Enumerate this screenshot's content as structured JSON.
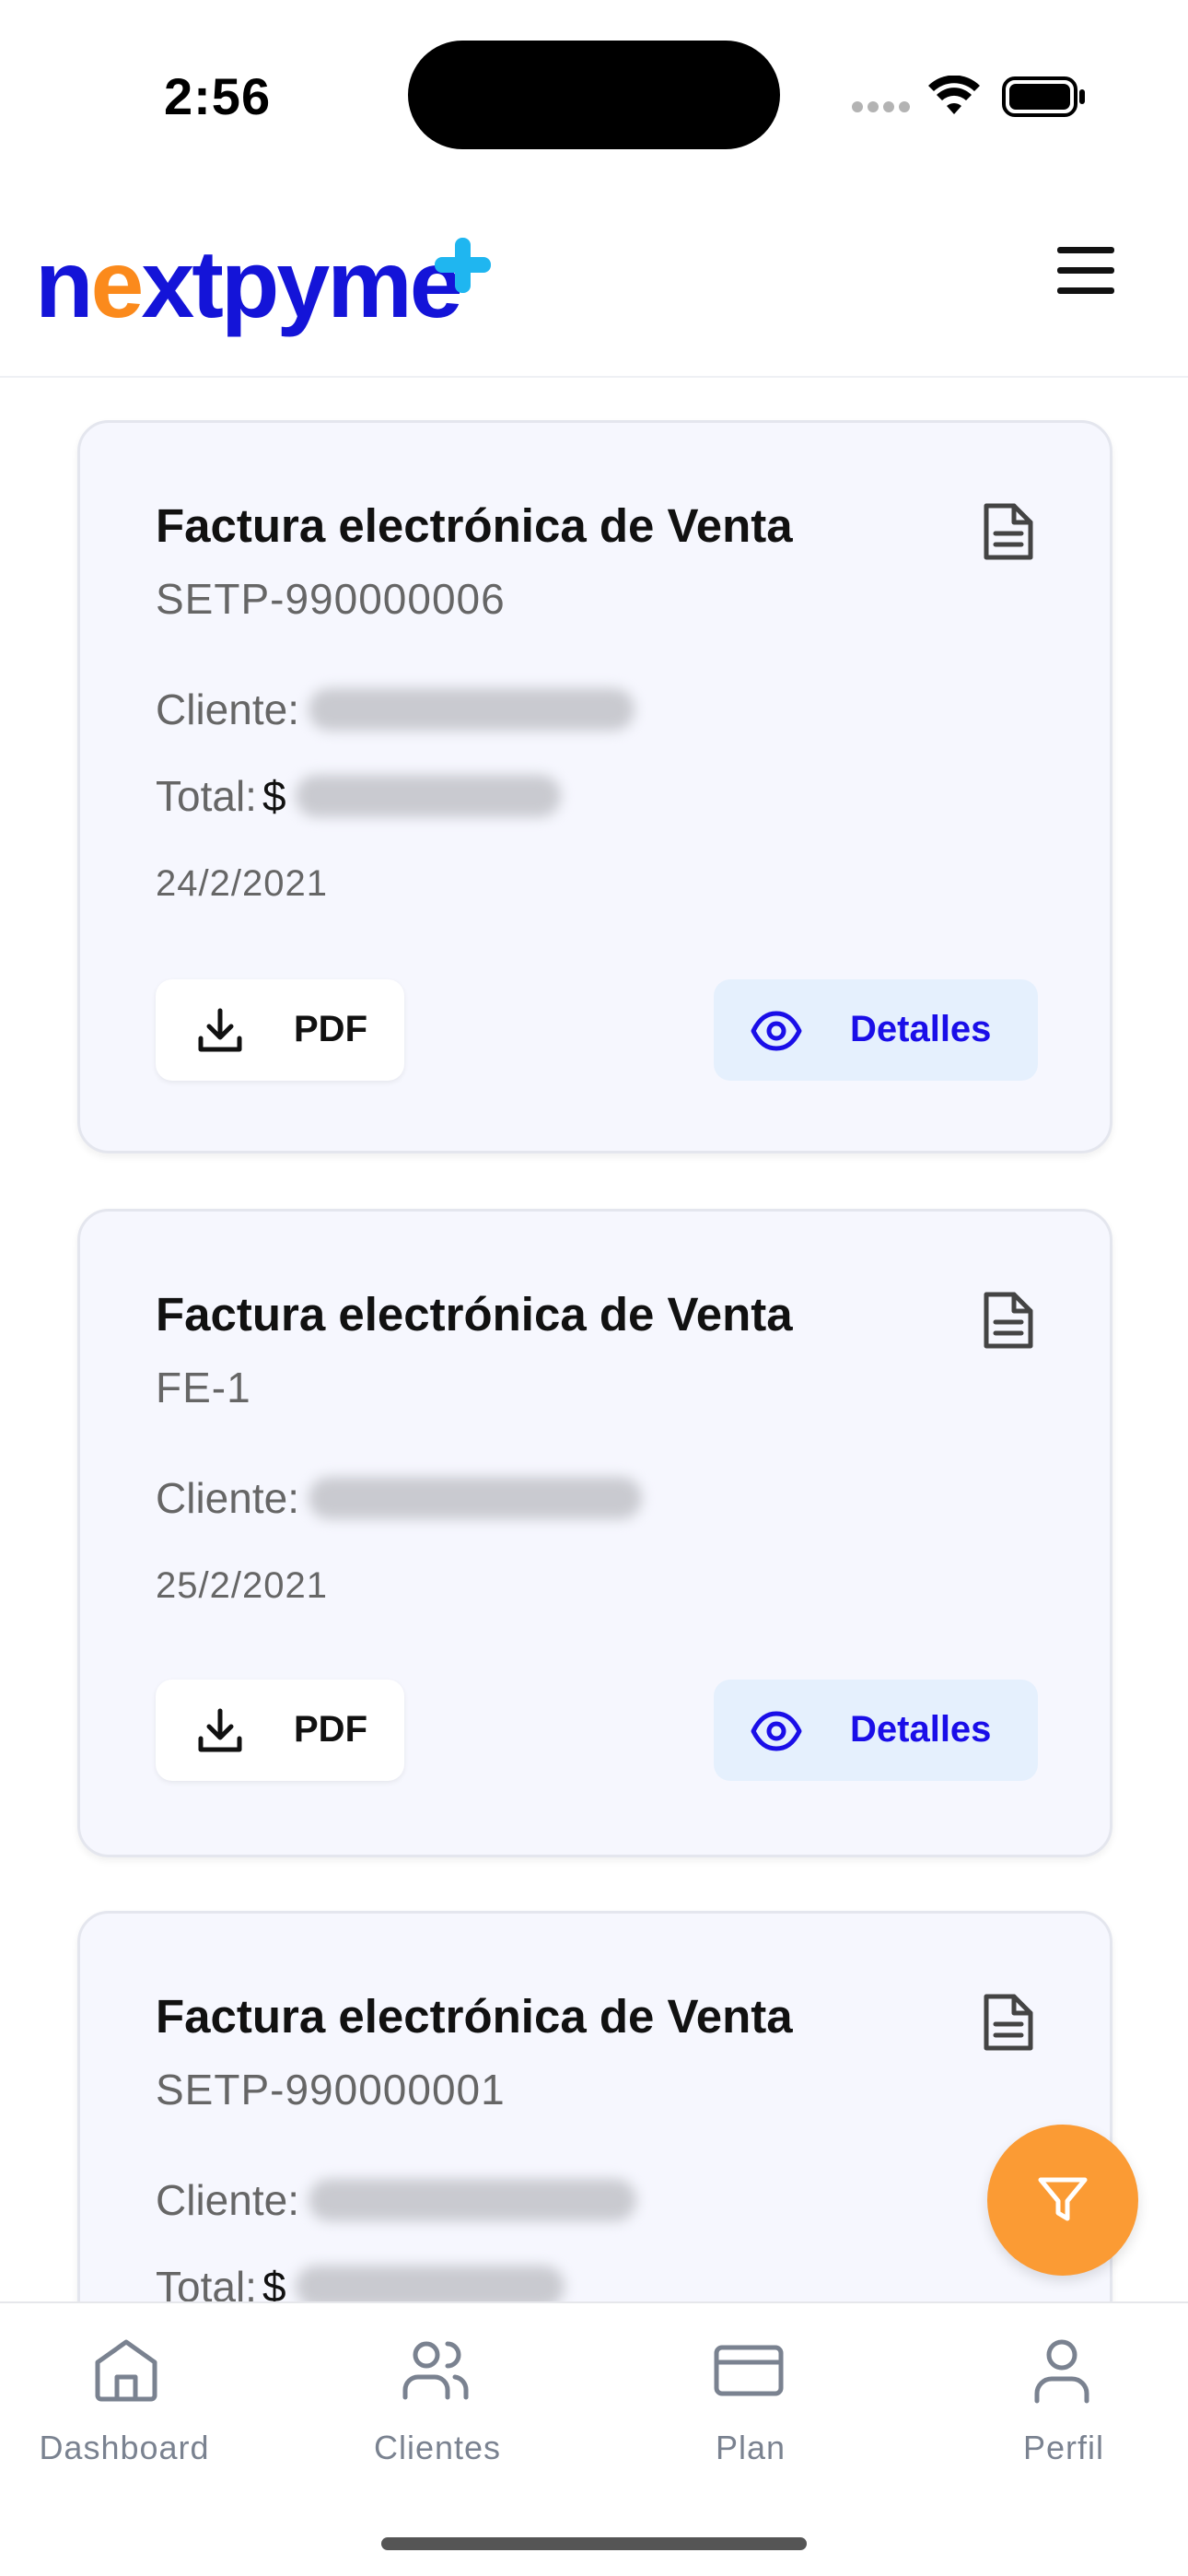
{
  "status_bar": {
    "time": "2:56",
    "signal_icon": "cellular-signal-icon",
    "wifi_icon": "wifi-icon",
    "battery_icon": "battery-icon"
  },
  "header": {
    "logo_text": "nextpyme",
    "logo_colors": {
      "primary": "#1414d8",
      "accent_orange": "#fb8a1c",
      "accent_plus": "#1fb6f0"
    },
    "menu_icon": "hamburger-menu-icon"
  },
  "invoices": [
    {
      "title": "Factura electrónica de Venta",
      "number": "SETP-990000006",
      "client_label": "Cliente:",
      "total_label": "Total:",
      "currency": "$",
      "date": "24/2/2021",
      "pdf_label": "PDF",
      "details_label": "Detalles"
    },
    {
      "title": "Factura electrónica de Venta",
      "number": "FE-1",
      "client_label": "Cliente:",
      "date": "25/2/2021",
      "pdf_label": "PDF",
      "details_label": "Detalles"
    },
    {
      "title": "Factura electrónica de Venta",
      "number": "SETP-990000001",
      "client_label": "Cliente:",
      "total_label": "Total:",
      "currency": "$"
    }
  ],
  "fab": {
    "icon": "filter-icon",
    "color": "#fb9b34"
  },
  "bottom_nav": {
    "items": [
      {
        "label": "Dashboard",
        "icon": "home-icon"
      },
      {
        "label": "Clientes",
        "icon": "users-icon"
      },
      {
        "label": "Plan",
        "icon": "credit-card-icon"
      },
      {
        "label": "Perfil",
        "icon": "user-icon"
      }
    ]
  },
  "colors": {
    "card_background": "#f6f7fe",
    "details_button_background": "#e5f0fd",
    "details_text": "#1a0ee8",
    "nav_inactive": "#7a8290"
  }
}
